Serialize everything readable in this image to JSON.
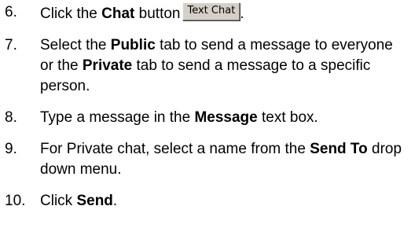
{
  "steps": [
    {
      "number": "6.",
      "pre": "Click the ",
      "bold1": "Chat",
      "mid": " button",
      "button_label": "Text Chat",
      "post": "."
    },
    {
      "number": "7.",
      "pre": "Select the ",
      "bold1": "Public",
      "mid": " tab to send a message to everyone or the ",
      "bold2": "Private",
      "post": " tab to send a message to a specific person."
    },
    {
      "number": "8.",
      "pre": "Type a message in the ",
      "bold1": "Message",
      "post": " text box."
    },
    {
      "number": "9.",
      "pre": "For Private chat, select a name from the ",
      "bold1": "Send To",
      "post": " drop down menu."
    },
    {
      "number": "10.",
      "pre": "Click ",
      "bold1": "Send",
      "post": "."
    }
  ]
}
